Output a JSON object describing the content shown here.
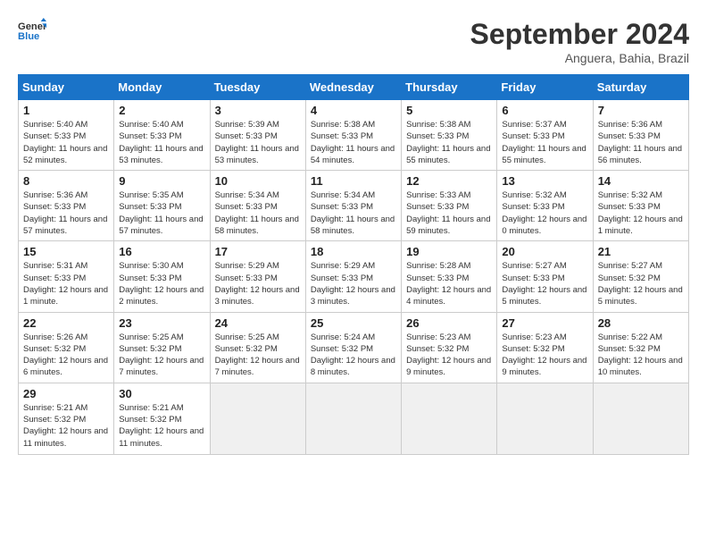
{
  "header": {
    "logo_line1": "General",
    "logo_line2": "Blue",
    "month": "September 2024",
    "location": "Anguera, Bahia, Brazil"
  },
  "weekdays": [
    "Sunday",
    "Monday",
    "Tuesday",
    "Wednesday",
    "Thursday",
    "Friday",
    "Saturday"
  ],
  "days": [
    {
      "num": "1",
      "sunrise": "5:40 AM",
      "sunset": "5:33 PM",
      "daylight": "11 hours and 52 minutes."
    },
    {
      "num": "2",
      "sunrise": "5:40 AM",
      "sunset": "5:33 PM",
      "daylight": "11 hours and 53 minutes."
    },
    {
      "num": "3",
      "sunrise": "5:39 AM",
      "sunset": "5:33 PM",
      "daylight": "11 hours and 53 minutes."
    },
    {
      "num": "4",
      "sunrise": "5:38 AM",
      "sunset": "5:33 PM",
      "daylight": "11 hours and 54 minutes."
    },
    {
      "num": "5",
      "sunrise": "5:38 AM",
      "sunset": "5:33 PM",
      "daylight": "11 hours and 55 minutes."
    },
    {
      "num": "6",
      "sunrise": "5:37 AM",
      "sunset": "5:33 PM",
      "daylight": "11 hours and 55 minutes."
    },
    {
      "num": "7",
      "sunrise": "5:36 AM",
      "sunset": "5:33 PM",
      "daylight": "11 hours and 56 minutes."
    },
    {
      "num": "8",
      "sunrise": "5:36 AM",
      "sunset": "5:33 PM",
      "daylight": "11 hours and 57 minutes."
    },
    {
      "num": "9",
      "sunrise": "5:35 AM",
      "sunset": "5:33 PM",
      "daylight": "11 hours and 57 minutes."
    },
    {
      "num": "10",
      "sunrise": "5:34 AM",
      "sunset": "5:33 PM",
      "daylight": "11 hours and 58 minutes."
    },
    {
      "num": "11",
      "sunrise": "5:34 AM",
      "sunset": "5:33 PM",
      "daylight": "11 hours and 58 minutes."
    },
    {
      "num": "12",
      "sunrise": "5:33 AM",
      "sunset": "5:33 PM",
      "daylight": "11 hours and 59 minutes."
    },
    {
      "num": "13",
      "sunrise": "5:32 AM",
      "sunset": "5:33 PM",
      "daylight": "12 hours and 0 minutes."
    },
    {
      "num": "14",
      "sunrise": "5:32 AM",
      "sunset": "5:33 PM",
      "daylight": "12 hours and 1 minute."
    },
    {
      "num": "15",
      "sunrise": "5:31 AM",
      "sunset": "5:33 PM",
      "daylight": "12 hours and 1 minute."
    },
    {
      "num": "16",
      "sunrise": "5:30 AM",
      "sunset": "5:33 PM",
      "daylight": "12 hours and 2 minutes."
    },
    {
      "num": "17",
      "sunrise": "5:29 AM",
      "sunset": "5:33 PM",
      "daylight": "12 hours and 3 minutes."
    },
    {
      "num": "18",
      "sunrise": "5:29 AM",
      "sunset": "5:33 PM",
      "daylight": "12 hours and 3 minutes."
    },
    {
      "num": "19",
      "sunrise": "5:28 AM",
      "sunset": "5:33 PM",
      "daylight": "12 hours and 4 minutes."
    },
    {
      "num": "20",
      "sunrise": "5:27 AM",
      "sunset": "5:33 PM",
      "daylight": "12 hours and 5 minutes."
    },
    {
      "num": "21",
      "sunrise": "5:27 AM",
      "sunset": "5:32 PM",
      "daylight": "12 hours and 5 minutes."
    },
    {
      "num": "22",
      "sunrise": "5:26 AM",
      "sunset": "5:32 PM",
      "daylight": "12 hours and 6 minutes."
    },
    {
      "num": "23",
      "sunrise": "5:25 AM",
      "sunset": "5:32 PM",
      "daylight": "12 hours and 7 minutes."
    },
    {
      "num": "24",
      "sunrise": "5:25 AM",
      "sunset": "5:32 PM",
      "daylight": "12 hours and 7 minutes."
    },
    {
      "num": "25",
      "sunrise": "5:24 AM",
      "sunset": "5:32 PM",
      "daylight": "12 hours and 8 minutes."
    },
    {
      "num": "26",
      "sunrise": "5:23 AM",
      "sunset": "5:32 PM",
      "daylight": "12 hours and 9 minutes."
    },
    {
      "num": "27",
      "sunrise": "5:23 AM",
      "sunset": "5:32 PM",
      "daylight": "12 hours and 9 minutes."
    },
    {
      "num": "28",
      "sunrise": "5:22 AM",
      "sunset": "5:32 PM",
      "daylight": "12 hours and 10 minutes."
    },
    {
      "num": "29",
      "sunrise": "5:21 AM",
      "sunset": "5:32 PM",
      "daylight": "12 hours and 11 minutes."
    },
    {
      "num": "30",
      "sunrise": "5:21 AM",
      "sunset": "5:32 PM",
      "daylight": "12 hours and 11 minutes."
    }
  ],
  "labels": {
    "sunrise": "Sunrise:",
    "sunset": "Sunset:",
    "daylight": "Daylight:"
  }
}
